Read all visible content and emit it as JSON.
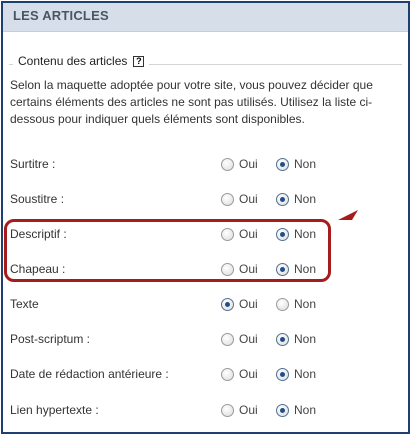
{
  "header": {
    "title": "LES ARTICLES"
  },
  "section": {
    "legend": "Contenu des articles",
    "help_icon_glyph": "?",
    "intro": "Selon la maquette adoptée pour votre site, vous pouvez décider que certains éléments des articles ne sont pas utilisés. Utilisez la liste ci-dessous pour indiquer quels éléments sont disponibles."
  },
  "options": {
    "yes_label": "Oui",
    "no_label": "Non"
  },
  "rows": [
    {
      "label": "Surtitre :",
      "selected": "non"
    },
    {
      "label": "Soustitre :",
      "selected": "non"
    },
    {
      "label": "Descriptif :",
      "selected": "non"
    },
    {
      "label": "Chapeau :",
      "selected": "non"
    },
    {
      "label": "Texte",
      "selected": "oui"
    },
    {
      "label": "Post-scriptum :",
      "selected": "non"
    },
    {
      "label": "Date de rédaction antérieure :",
      "selected": "non"
    },
    {
      "label": "Lien hypertexte :",
      "selected": "non"
    }
  ],
  "colors": {
    "border": "#1f3f6f",
    "header_bg": "#d6dfe9",
    "annotation_red": "#a51c1c",
    "radio_selected": "#1f4e8c"
  }
}
